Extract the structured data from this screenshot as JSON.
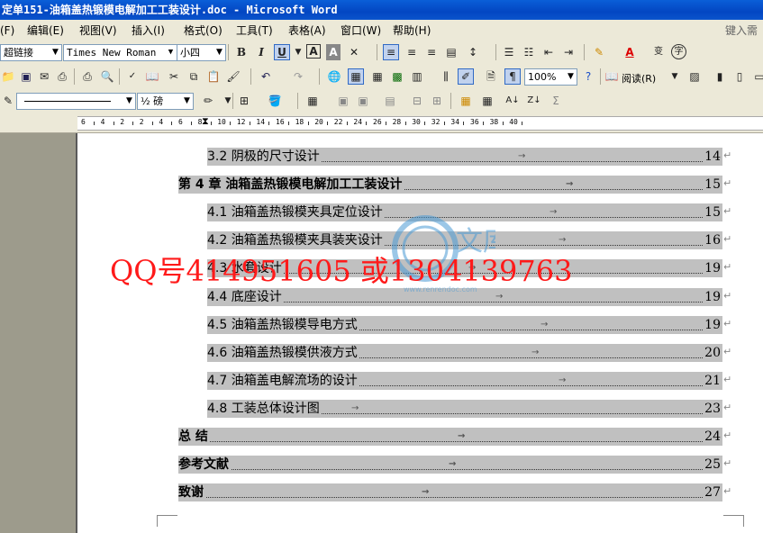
{
  "window": {
    "title": "定单151-油箱盖热锻模电解加工工装设计.doc - Microsoft Word"
  },
  "menu": {
    "items": [
      "(F)",
      "编辑(E)",
      "视图(V)",
      "插入(I)",
      "格式(O)",
      "工具(T)",
      "表格(A)",
      "窗口(W)",
      "帮助(H)"
    ],
    "help_placeholder": "键入需"
  },
  "toolbar": {
    "style_value": "超链接",
    "font_value": "Times New Roman",
    "size_value": "小四",
    "zoom_value": "100%",
    "read_label": "阅读(R)",
    "bold": "B",
    "italic": "I",
    "underline": "U",
    "line_weight": "½ 磅"
  },
  "ruler": {
    "labels": [
      "6",
      "4",
      "2",
      "2",
      "4",
      "6",
      "8",
      "10",
      "12",
      "14",
      "16",
      "18",
      "20",
      "22",
      "24",
      "26",
      "28",
      "30",
      "32",
      "34",
      "36",
      "38",
      "40"
    ]
  },
  "toc": [
    {
      "label": "3.2 阴极的尺寸设计",
      "page": "14",
      "chapter": false
    },
    {
      "label": "第 4 章  油箱盖热锻模电解加工工装设计",
      "page": "15",
      "chapter": true
    },
    {
      "label": "4.1 油箱盖热锻模夹具定位设计",
      "page": "15",
      "chapter": false
    },
    {
      "label": "4.2 油箱盖热锻模夹具装夹设计",
      "page": "16",
      "chapter": false
    },
    {
      "label": "4.3 水套设计",
      "page": "19",
      "chapter": false
    },
    {
      "label": "4.4 底座设计",
      "page": "19",
      "chapter": false
    },
    {
      "label": "4.5 油箱盖热锻模导电方式",
      "page": "19",
      "chapter": false
    },
    {
      "label": "4.6 油箱盖热锻模供液方式",
      "page": "20",
      "chapter": false
    },
    {
      "label": "4.7 油箱盖电解流场的设计",
      "page": "21",
      "chapter": false
    },
    {
      "label": "4.8 工装总体设计图",
      "page": "23",
      "chapter": false
    },
    {
      "label": "总  结",
      "page": "24",
      "chapter": true
    },
    {
      "label": "参考文献",
      "page": "25",
      "chapter": true
    },
    {
      "label": "致谢",
      "page": "27",
      "chapter": true
    }
  ],
  "watermark": {
    "text": "QQ号414951605  或1304139763",
    "logo_text": "文库",
    "logo_url_text": "www.renrendoc.com"
  },
  "colors": {
    "titlebar": "#0a54cc",
    "toc_highlight": "#c0c0c0",
    "watermark": "#ff1a1a"
  }
}
